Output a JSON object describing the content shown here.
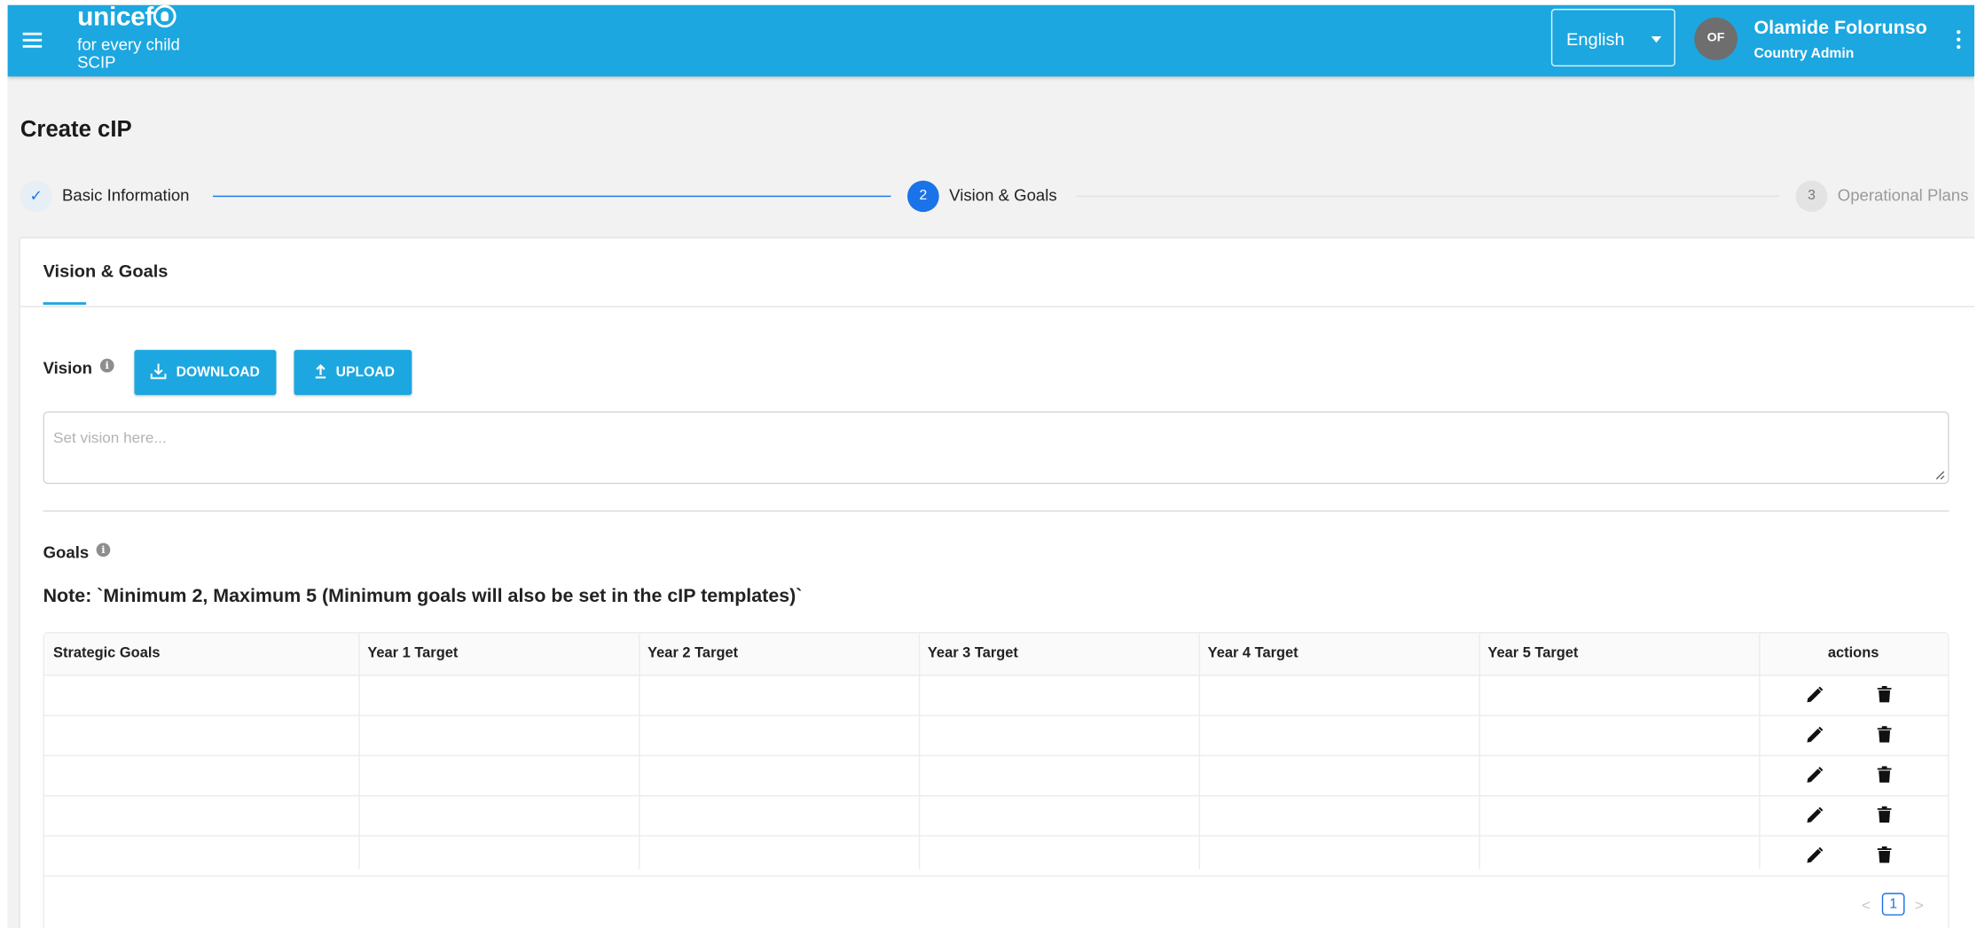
{
  "header": {
    "logo_word": "unicef",
    "logo_tagline": "for every child",
    "app_name": "SCIP",
    "language": "English",
    "user_initials": "OF",
    "user_name": "Olamide Folorunso",
    "user_role": "Country Admin"
  },
  "page": {
    "title": "Create cIP"
  },
  "stepper": {
    "steps": [
      {
        "index": "✓",
        "label": "Basic Information",
        "state": "completed"
      },
      {
        "index": "2",
        "label": "Vision & Goals",
        "state": "active"
      },
      {
        "index": "3",
        "label": "Operational Plans",
        "state": "pending"
      }
    ]
  },
  "card": {
    "tab": "Vision & Goals",
    "vision": {
      "label": "Vision",
      "download_label": "DOWNLOAD",
      "upload_label": "UPLOAD",
      "placeholder": "Set vision here...",
      "value": ""
    },
    "goals": {
      "label": "Goals",
      "note": "Note: `Minimum 2, Maximum 5 (Minimum goals will also be set in the cIP templates)`",
      "columns": [
        "Strategic Goals",
        "Year 1 Target",
        "Year 2 Target",
        "Year 3 Target",
        "Year 4 Target",
        "Year 5 Target",
        "actions"
      ],
      "rows": [
        [
          "",
          "",
          "",
          "",
          "",
          ""
        ],
        [
          "",
          "",
          "",
          "",
          "",
          ""
        ],
        [
          "",
          "",
          "",
          "",
          "",
          ""
        ],
        [
          "",
          "",
          "",
          "",
          "",
          ""
        ],
        [
          "",
          "",
          "",
          "",
          "",
          ""
        ]
      ],
      "pagination": {
        "current_page": "1"
      }
    }
  },
  "colors": {
    "brand": "#1ca7e0",
    "accent": "#1a73e8",
    "page_bg": "#f2f2f2"
  }
}
